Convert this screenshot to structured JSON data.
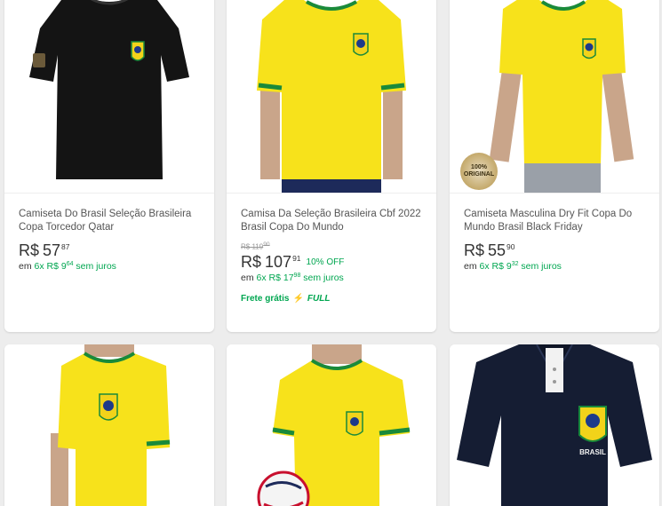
{
  "colors": {
    "accent_green": "#00a650",
    "jersey_yellow": "#f7e21b",
    "jersey_green": "#1a8a3a",
    "black_shirt": "#141414",
    "navy_polo": "#151d33"
  },
  "products": [
    {
      "title": "Camiseta Do Brasil Seleção Brasileira Copa Torcedor Qatar",
      "price_currency": "R$",
      "price_int": "57",
      "price_cents": "87",
      "installments_prefix": "em",
      "installments_value": "6x R$ 9",
      "installments_cents": "64",
      "installments_suffix": "sem juros",
      "image_icon": "black-brazil-tshirt"
    },
    {
      "title": "Camisa Da Seleção Brasileira Cbf 2022 Brasil Copa Do Mundo",
      "old_price": "R$ 119",
      "old_price_cents": "90",
      "price_currency": "R$",
      "price_int": "107",
      "price_cents": "91",
      "discount": "10% OFF",
      "installments_prefix": "em",
      "installments_value": "6x R$ 17",
      "installments_cents": "98",
      "installments_suffix": "sem juros",
      "shipping": "Frete grátis",
      "full_label": "FULL",
      "image_icon": "yellow-brazil-jersey"
    },
    {
      "title": "Camiseta Masculina Dry Fit Copa Do Mundo Brasil Black Friday",
      "price_currency": "R$",
      "price_int": "55",
      "price_cents": "90",
      "installments_prefix": "em",
      "installments_value": "6x R$ 9",
      "installments_cents": "32",
      "installments_suffix": "sem juros",
      "seal_text": "100% ORIGINAL",
      "image_icon": "yellow-brazil-jersey"
    },
    {
      "image_icon": "yellow-brazil-jersey"
    },
    {
      "image_icon": "yellow-brazil-jersey-with-ball"
    },
    {
      "image_icon": "navy-brazil-polo",
      "crest_label": "BRASIL"
    }
  ]
}
